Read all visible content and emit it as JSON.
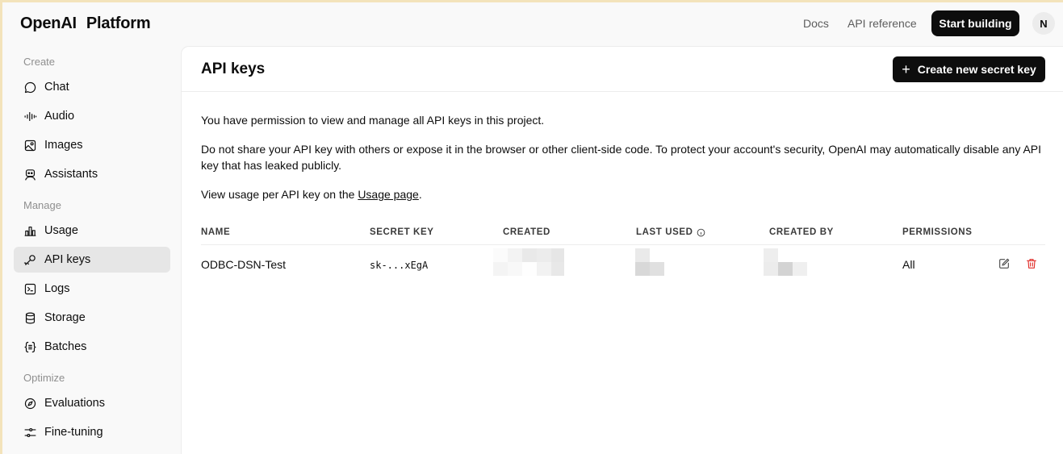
{
  "brand": {
    "name_part1": "OpenAI",
    "name_part2": "Platform"
  },
  "topnav": {
    "docs": "Docs",
    "api_reference": "API reference",
    "start_building": "Start building",
    "avatar_initial": "N"
  },
  "sidebar": {
    "sections": [
      {
        "label": "Create"
      },
      {
        "label": "Manage"
      },
      {
        "label": "Optimize"
      }
    ],
    "items": [
      {
        "label": "Chat",
        "icon": "chat-bubble-icon"
      },
      {
        "label": "Audio",
        "icon": "audio-waveform-icon"
      },
      {
        "label": "Images",
        "icon": "image-icon"
      },
      {
        "label": "Assistants",
        "icon": "robot-icon"
      },
      {
        "label": "Usage",
        "icon": "bar-chart-icon"
      },
      {
        "label": "API keys",
        "icon": "key-icon",
        "active": true
      },
      {
        "label": "Logs",
        "icon": "terminal-icon"
      },
      {
        "label": "Storage",
        "icon": "database-icon"
      },
      {
        "label": "Batches",
        "icon": "braces-icon"
      },
      {
        "label": "Evaluations",
        "icon": "compass-icon"
      },
      {
        "label": "Fine-tuning",
        "icon": "sliders-icon"
      }
    ]
  },
  "main": {
    "title": "API keys",
    "create_button": "Create new secret key",
    "paragraphs": {
      "p1": "You have permission to view and manage all API keys in this project.",
      "p2": "Do not share your API key with others or expose it in the browser or other client-side code. To protect your account's security, OpenAI may automatically disable any API key that has leaked publicly.",
      "p3_prefix": "View usage per API key on the ",
      "p3_link": "Usage page",
      "p3_suffix": "."
    },
    "table": {
      "headers": [
        "NAME",
        "SECRET KEY",
        "CREATED",
        "LAST USED",
        "CREATED BY",
        "PERMISSIONS"
      ],
      "rows": [
        {
          "name": "ODBC-DSN-Test",
          "secret_key": "sk-...xEgA",
          "permissions": "All"
        }
      ]
    }
  },
  "colors": {
    "accent_dark": "#0d0d0d",
    "delete_red": "#e02e2a",
    "active_bg": "#e6e6e6"
  }
}
